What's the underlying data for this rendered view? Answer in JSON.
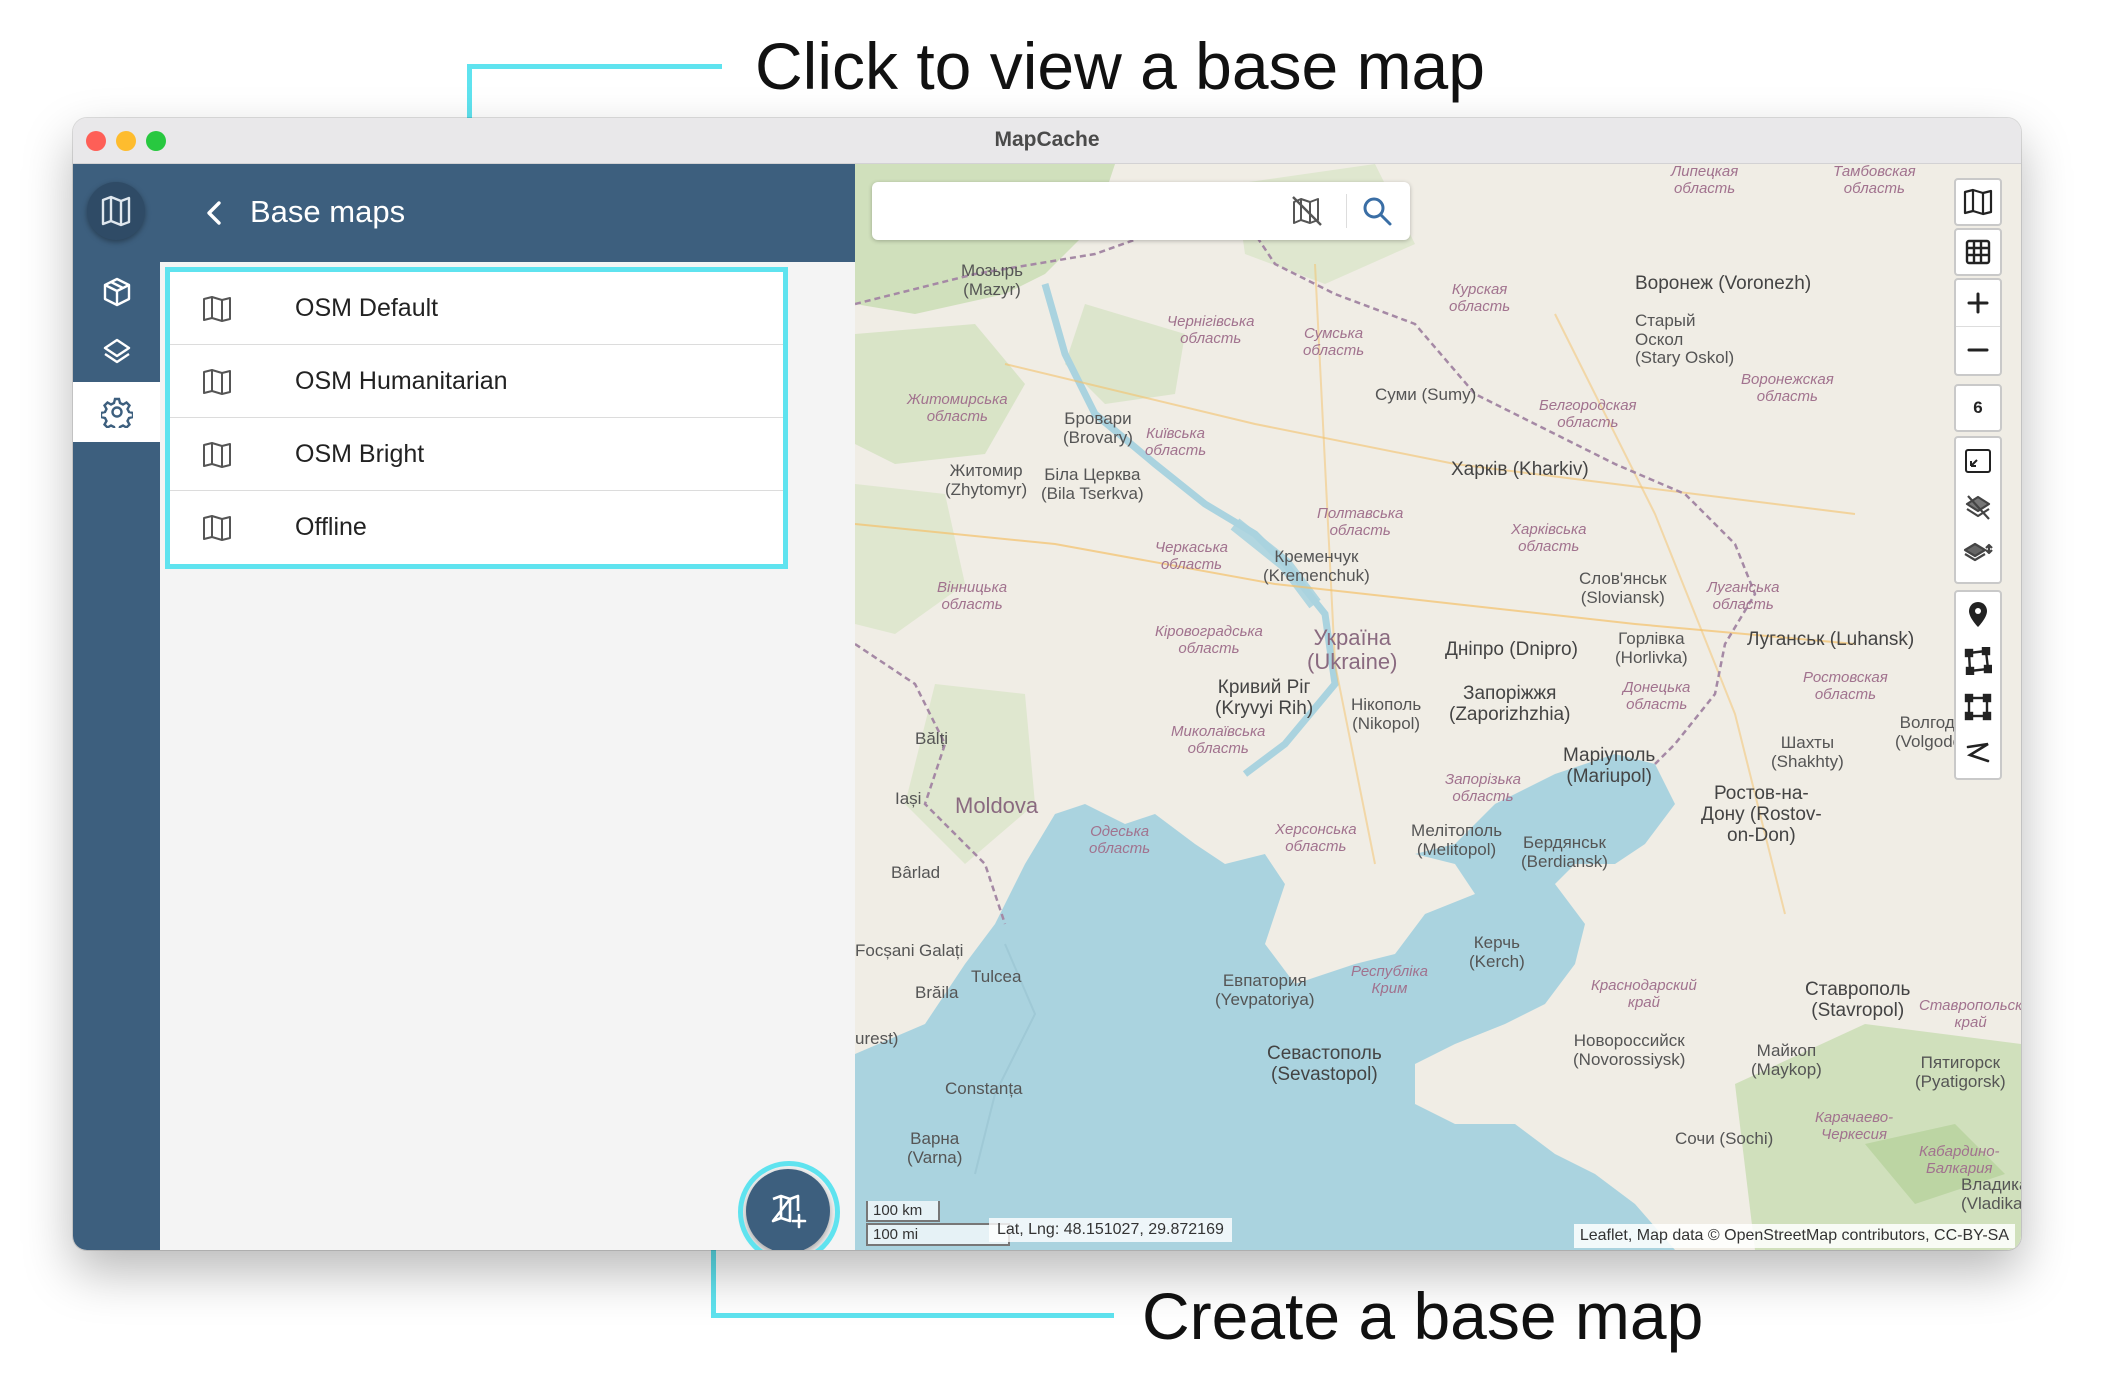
{
  "annotations": {
    "top": "Click to view a base map",
    "bottom": "Create a base map"
  },
  "window": {
    "title": "MapCache"
  },
  "panel": {
    "title": "Base maps",
    "items": [
      {
        "label": "OSM Default",
        "icon": "map-icon"
      },
      {
        "label": "OSM Humanitarian",
        "icon": "map-icon"
      },
      {
        "label": "OSM Bright",
        "icon": "map-icon"
      },
      {
        "label": "Offline",
        "icon": "map-icon"
      }
    ],
    "fab_icon": "add-map-icon"
  },
  "rail": {
    "items": [
      {
        "name": "projects",
        "icon": "cube-icon"
      },
      {
        "name": "layers",
        "icon": "layers-icon"
      },
      {
        "name": "settings",
        "icon": "gear-icon",
        "active": true
      }
    ]
  },
  "map": {
    "search": {
      "placeholder": "",
      "value": ""
    },
    "zoom_level": "6",
    "scale": {
      "km": "100 km",
      "mi": "100 mi"
    },
    "coords": "Lat, Lng: 48.151027, 29.872169",
    "attribution": "Leaflet, Map data © OpenStreetMap contributors, CC-BY-SA",
    "labels": {
      "mozyr": "Мозырь\n(Mazyr)",
      "voronezh": "Воронеж (Voronezh)",
      "stary_oskol": "Старый\nОскол\n(Stary Oskol)",
      "sumy": "Суми (Sumy)",
      "brovary": "Бровари\n(Brovary)",
      "zhytomyr": "Житомир\n(Zhytomyr)",
      "bila_tserkva": "Біла Церква\n(Bila Tserkva)",
      "kharkiv": "Харків (Kharkiv)",
      "kremenchuk": "Кременчук\n(Kremenchuk)",
      "sloviansk": "Слов'янськ\n(Sloviansk)",
      "horlivka": "Горлівка\n(Horlivka)",
      "luhansk": "Луганськ (Luhansk)",
      "ukraine": "Україна\n(Ukraine)",
      "dnipro": "Дніпро (Dnipro)",
      "kryvyi_rih": "Кривий Ріг\n(Kryvyi Rih)",
      "nikopol": "Нікополь\n(Nikopol)",
      "zaporizhzhia": "Запоріжжя\n(Zaporizhzhia)",
      "volgodonsk": "Волгодонск\n(Volgodonsk)",
      "shakhty": "Шахты\n(Shakhty)",
      "mariupol": "Маріуполь\n(Mariupol)",
      "rostov": "Ростов-на-\nДону (Rostov-\non-Don)",
      "moldova": "Moldova",
      "balti": "Bălți",
      "iasi": "Iași",
      "barlad": "Bârlad",
      "melitopol": "Мелітополь\n(Melitopol)",
      "berdiansk": "Бердянськ\n(Berdiansk)",
      "focsani": "Focșani",
      "galati": "Galați",
      "tulcea": "Tulcea",
      "braila": "Brăila",
      "kerch": "Керчь\n(Kerch)",
      "yevpatoriya": "Евпатория\n(Yevpatoriya)",
      "stavropol": "Ставрополь\n(Stavropol)",
      "novorossiysk": "Новороссийск\n(Novorossiysk)",
      "sevastopol": "Севастополь\n(Sevastopol)",
      "maykop": "Майкоп\n(Maykop)",
      "pyatigorsk": "Пятигорск\n(Pyatigorsk)",
      "constanta": "Constanța",
      "varna": "Варна\n(Varna)",
      "sochi": "Сочи (Sochi)",
      "bucharest": "urest)",
      "vladikavkaz": "Владикавк\n(Vladikavk"
    },
    "regions": {
      "chernihiv": "Чернігівська\nобласть",
      "sumy_obl": "Сумська\nобласть",
      "kursk": "Курская\nобласть",
      "zhytomyr_obl": "Житомирська\nобласть",
      "kyiv_obl": "Київська\nобласть",
      "belgorod": "Белгородская\nобласть",
      "voronezh_obl": "Воронежская\nобласть",
      "poltava": "Полтавська\nобласть",
      "kharkiv_obl": "Харківська\nобласть",
      "cherkasy": "Черкаська\nобласть",
      "vinnytsia": "Вінницька\nобласть",
      "luhansk_obl": "Луганська\nобласть",
      "kirovohrad": "Кіровоградська\nобласть",
      "donetsk": "Донецька\nобласть",
      "rostov_obl": "Ростовская\nобласть",
      "mykolaiv": "Миколаївська\nобласть",
      "zaporizhzhia_obl": "Запорізька\nобласть",
      "odesa": "Одеська\nобласть",
      "kherson": "Херсонська\nобласть",
      "crimea": "Республіка\nКрим",
      "krasnodar": "Краснодарский\nкрай",
      "stavropol_krai": "Ставропольск\nкрай",
      "karachay": "Карачаево-\nЧеркесия",
      "kabardino": "Кабардино-\nБалкария",
      "lipetsk": "Липецкая\nобласть",
      "tambov": "Тамбовская\nобласть"
    },
    "colors": {
      "land": "#f0ede5",
      "sea": "#aad3df",
      "forest": "#c8dcb2",
      "border": "#a589a5"
    }
  },
  "colors": {
    "primary": "#3d5f7e",
    "highlight": "#5fe3ef"
  }
}
